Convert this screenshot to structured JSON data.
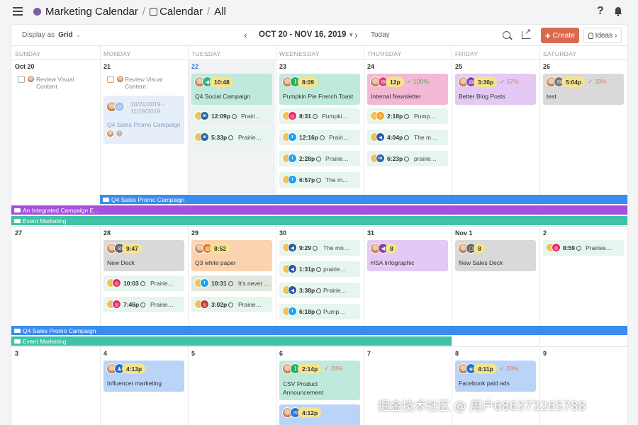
{
  "header": {
    "app": "Marketing Calendar",
    "section": "Calendar",
    "view": "All",
    "sep": "/"
  },
  "toolbar": {
    "display_label": "Display as",
    "display_value": "Grid",
    "range": "OCT 20 - NOV 16, 2019",
    "today": "Today",
    "create": "Create",
    "ideas": "Ideas"
  },
  "weekdays": [
    "SUNDAY",
    "MONDAY",
    "TUESDAY",
    "WEDNESDAY",
    "THURSDAY",
    "FRIDAY",
    "SATURDAY"
  ],
  "weeks": [
    [
      "Oct 20",
      "21",
      "22",
      "23",
      "24",
      "25",
      "26"
    ],
    [
      "27",
      "28",
      "29",
      "30",
      "31",
      "Nov 1",
      "2"
    ],
    [
      "3",
      "4",
      "5",
      "6",
      "7",
      "8",
      "9"
    ]
  ],
  "tasks": {
    "sun": "Review Visual Content",
    "mon": "Review Visual Content"
  },
  "campaign_card": {
    "dates": "10/21/2019 - 11/19/2019",
    "title": "Q4 Sales Promo Campaign"
  },
  "cards": {
    "tue1": {
      "time": "10:48",
      "title": "Q4 Social Campaign"
    },
    "wed1": {
      "time": "8:09",
      "title": "Pumpkin Pie French Toast"
    },
    "thu1": {
      "time": "12p",
      "pct": "✓ 100%",
      "title": "Internal Newsletter"
    },
    "fri1": {
      "time": "3:30p",
      "pct": "✓ 57%",
      "title": "Better Blog Posts"
    },
    "sat1": {
      "time": "5:04p",
      "pct": "✓ 33%",
      "title": "test"
    },
    "mon2": {
      "time": "9:47",
      "title": "New Deck"
    },
    "tue2": {
      "time": "8:52",
      "title": "Q3 white paper"
    },
    "thu2": {
      "time": "8",
      "title": "HSA Infographic"
    },
    "fri2": {
      "time": "8",
      "title": "New Sales Deck"
    },
    "mon3": {
      "time": "4:13p",
      "title": "Influencer marketing"
    },
    "wed3": {
      "time": "2:14p",
      "pct": "✓ 28%",
      "title": "CSV Product Announcement"
    },
    "wed3b": {
      "time": "4:12p"
    },
    "fri3": {
      "time": "4:11p",
      "pct": "✓ 33%",
      "title": "Facebook paid ads"
    }
  },
  "minis": {
    "tue_a": {
      "time": "12:09p",
      "title": "Prairi…"
    },
    "tue_b": {
      "time": "5:33p",
      "title": "Prairie…"
    },
    "wed_a": {
      "time": "8:31",
      "title": "Pumpki…"
    },
    "wed_b": {
      "time": "12:16p",
      "title": "Prairi…"
    },
    "wed_c": {
      "time": "2:28p",
      "title": "Prairie…"
    },
    "wed_d": {
      "time": "6:57p",
      "title": "The m…"
    },
    "thu_a": {
      "time": "2:18p",
      "title": "Pump…"
    },
    "thu_b": {
      "time": "4:04p",
      "title": "The m…"
    },
    "thu_c": {
      "time": "6:23p",
      "title": "prairie…"
    },
    "sat2": {
      "time": "8:59",
      "title": "Prairies…"
    },
    "mon2a": {
      "time": "10:03",
      "title": "Prairie…"
    },
    "mon2b": {
      "time": "7:46p",
      "title": "Prairie…"
    },
    "tue2a": {
      "time": "10:31",
      "title": "It's never …"
    },
    "tue2b": {
      "time": "3:02p",
      "title": "Prairie…"
    },
    "wed2a": {
      "time": "9:29",
      "title": "The mo…"
    },
    "wed2b": {
      "time": "1:31p",
      "title": "prairie…"
    },
    "wed2c": {
      "time": "3:38p",
      "title": "Prairie…"
    },
    "wed2d": {
      "time": "6:18p",
      "title": "Pump…"
    }
  },
  "bands": {
    "q4": "Q4 Sales Promo Campaign",
    "integrated": "An Integrated Campaign E…",
    "event": "Event Marketing"
  },
  "watermark": "掘金技术社区 @ 用户686373265788",
  "colors": {
    "accent": "#d9694f",
    "blue_band": "#3b8cf0",
    "purple_band": "#a64fe0",
    "teal_band": "#3fc2a5"
  }
}
